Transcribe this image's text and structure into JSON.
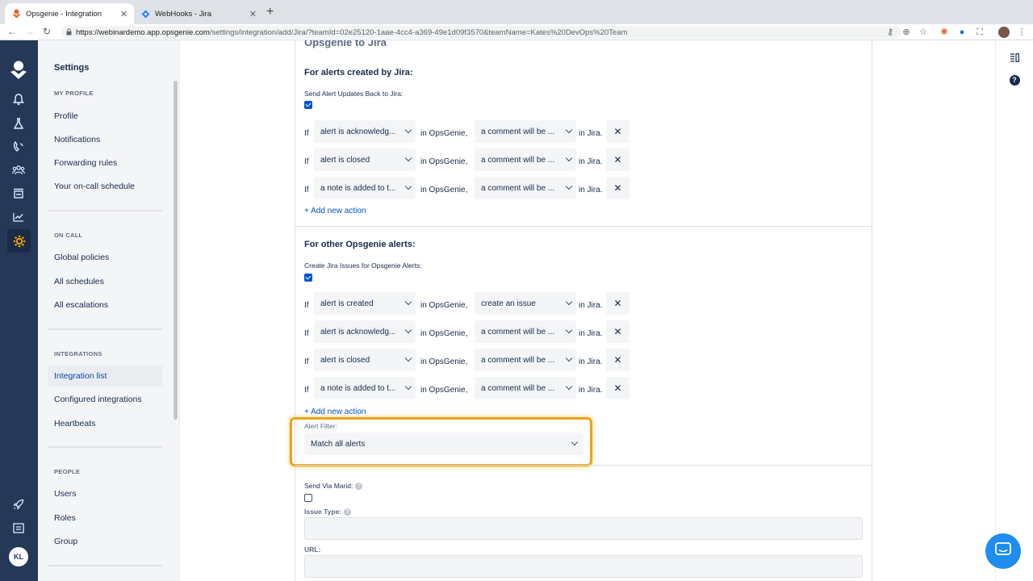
{
  "browser": {
    "tabs": [
      {
        "title": "Opsgenie - Integration",
        "active": true
      },
      {
        "title": "WebHooks - Jira",
        "active": false
      }
    ],
    "url_host": "https://webinardemo.app.opsgenie.com",
    "url_path": "/settings/integration/add/Jira/?teamId=02e25120-1aae-4cc4-a369-49e1d09f3570&teamName=Kates%20DevOps%20Team"
  },
  "rail": {
    "avatar_initials": "KL"
  },
  "sidebar": {
    "title": "Settings",
    "my_profile": {
      "heading": "MY PROFILE",
      "items": [
        "Profile",
        "Notifications",
        "Forwarding rules",
        "Your on-call schedule"
      ]
    },
    "on_call": {
      "heading": "ON CALL",
      "items": [
        "Global policies",
        "All schedules",
        "All escalations"
      ]
    },
    "integrations": {
      "heading": "INTEGRATIONS",
      "items": [
        "Integration list",
        "Configured integrations",
        "Heartbeats"
      ],
      "selected": "Integration list"
    },
    "people": {
      "heading": "PEOPLE",
      "items": [
        "Users",
        "Roles",
        "Group"
      ]
    }
  },
  "main": {
    "partial_heading": "Opsgenie to Jira",
    "jira_alerts": {
      "title": "For alerts created by Jira:",
      "toggle_label": "Send Alert Updates Back to Jira:",
      "checked": true,
      "rules": [
        {
          "if": "If",
          "condition": "alert is acknowledg...",
          "mid": "in OpsGenie,",
          "action": "a comment will be ...",
          "end": "in Jira."
        },
        {
          "if": "If",
          "condition": "alert is closed",
          "mid": "in OpsGenie,",
          "action": "a comment will be ...",
          "end": "in Jira."
        },
        {
          "if": "If",
          "condition": "a note is added to t...",
          "mid": "in OpsGenie,",
          "action": "a comment will be ...",
          "end": "in Jira."
        }
      ],
      "add_action": "+ Add new action"
    },
    "other_alerts": {
      "title": "For other Opsgenie alerts:",
      "toggle_label": "Create Jira Issues for Opsgenie Alerts:",
      "checked": true,
      "rules": [
        {
          "if": "If",
          "condition": "alert is created",
          "mid": "in OpsGenie,",
          "action": "create an issue",
          "end": "in Jira."
        },
        {
          "if": "If",
          "condition": "alert is acknowledg...",
          "mid": "in OpsGenie,",
          "action": "a comment will be ...",
          "end": "in Jira."
        },
        {
          "if": "If",
          "condition": "alert is closed",
          "mid": "in OpsGenie,",
          "action": "a comment will be ...",
          "end": "in Jira."
        },
        {
          "if": "If",
          "condition": "a note is added to t...",
          "mid": "in OpsGenie,",
          "action": "a comment will be ...",
          "end": "in Jira."
        }
      ],
      "add_action": "+ Add new action",
      "filter_label": "Alert Filter:",
      "filter_value": "Match all alerts"
    },
    "send_via_marid": {
      "label": "Send Via Marid:",
      "checked": false
    },
    "issue_type": {
      "label": "Issue Type:",
      "value": ""
    },
    "url_field": {
      "label": "URL:",
      "value": ""
    },
    "delete_glyph": "✕"
  },
  "colors": {
    "rail_bg": "#253858",
    "accent": "#0052cc",
    "highlight": "#e8a515",
    "chat": "#1f8ded"
  }
}
